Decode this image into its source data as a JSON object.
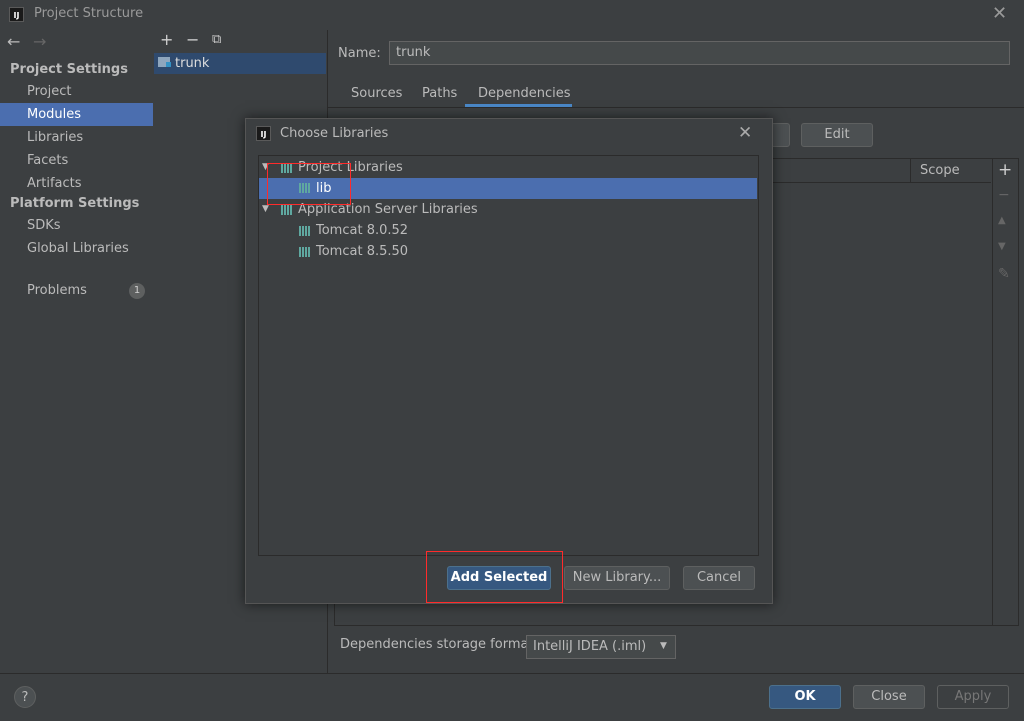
{
  "window": {
    "title": "Project Structure",
    "app_icon_text": "IJ"
  },
  "nav": {
    "back_icon": "arrow-left-icon",
    "forward_icon": "arrow-right-icon"
  },
  "sidebar": {
    "project_settings_header": "Project Settings",
    "project_items": [
      "Project",
      "Modules",
      "Libraries",
      "Facets",
      "Artifacts"
    ],
    "selected_item": "Modules",
    "platform_settings_header": "Platform Settings",
    "platform_items": [
      "SDKs",
      "Global Libraries"
    ],
    "problems_label": "Problems",
    "problems_count": "1"
  },
  "modules": {
    "items": [
      "trunk"
    ]
  },
  "module_detail": {
    "name_label": "Name:",
    "name_value": "trunk",
    "tabs": [
      "Sources",
      "Paths",
      "Dependencies"
    ],
    "active_tab": "Dependencies",
    "edit_button": "Edit",
    "scope_header": "Scope",
    "storage_label": "Dependencies storage format:",
    "storage_value": "IntelliJ IDEA (.iml)"
  },
  "dialog": {
    "title": "Choose Libraries",
    "groups": [
      {
        "label": "Project Libraries",
        "children": [
          "lib"
        ]
      },
      {
        "label": "Application Server Libraries",
        "children": [
          "Tomcat 8.0.52",
          "Tomcat 8.5.50"
        ]
      }
    ],
    "selected": "lib",
    "add_selected_button": "Add Selected",
    "new_library_button": "New Library...",
    "cancel_button": "Cancel"
  },
  "footer": {
    "help_label": "?",
    "ok_button": "OK",
    "close_button": "Close",
    "apply_button": "Apply"
  },
  "colors": {
    "background": "#3c3f41",
    "selection": "#4b6eaf",
    "primary_button": "#365880",
    "highlight_box": "#ff2b2b",
    "library_icon": "#5fa8a0"
  }
}
